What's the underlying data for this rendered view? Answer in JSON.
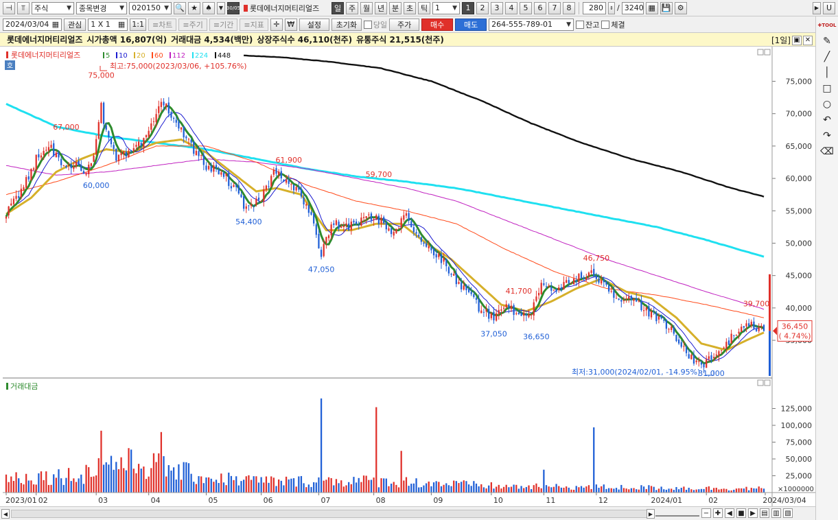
{
  "toolbar1": {
    "market": "주식",
    "stock_change": "종목변경",
    "code": "020150",
    "name": "롯데에너지머티리얼즈",
    "interval_selected": "일",
    "intervals": [
      "주",
      "월",
      "년",
      "분",
      "초",
      "틱"
    ],
    "count_value": "1",
    "pages": [
      "1",
      "2",
      "3",
      "4",
      "5",
      "6",
      "7",
      "8"
    ],
    "active_page": "1",
    "bars_value": "280",
    "slash": "/",
    "bars_total": "3240",
    "badge": "30/05",
    "right_u": "U"
  },
  "toolbar2": {
    "date": "2024/03/04",
    "watch": "관심",
    "layout": "1 X 1",
    "ratio": "1:1",
    "chart_btn": "≡차트",
    "period_btn": "≡주기",
    "range_btn": "≡기간",
    "indicator_btn": "≡지표",
    "won": "₩",
    "settings": "설정",
    "reset": "초기화",
    "today": "당일",
    "price": "주가",
    "buy": "매수",
    "sell": "매도",
    "account": "264-555-789-01",
    "balance": "잔고",
    "filled": "체결"
  },
  "infobar": {
    "name": "롯데에너지머티리얼즈",
    "mktcap": "시가총액 16,807(억)",
    "turnover": "거래대금 4,534(백만)",
    "listed": "상장주식수 46,110(천주)",
    "float": "유통주식 21,515(천주)",
    "period_badge": "[1일]"
  },
  "colors": {
    "up": "#e0302a",
    "down": "#1f5fd6",
    "ma5": "#2e8b2e",
    "ma10": "#1a1ad0",
    "ma20": "#d6b02a",
    "ma60": "#ff4a1a",
    "ma112": "#c020c0",
    "ma224": "#1fe0f0",
    "ma448": "#111111"
  },
  "chart_data": {
    "type": "candlestick",
    "legend_title": "롯데에너지머티리얼즈",
    "ma_labels": [
      {
        "period": "5",
        "color": "#2e8b2e"
      },
      {
        "period": "10",
        "color": "#1a1ad0"
      },
      {
        "period": "20",
        "color": "#d6b02a"
      },
      {
        "period": "60",
        "color": "#ff4a1a"
      },
      {
        "period": "112",
        "color": "#c020c0"
      },
      {
        "period": "224",
        "color": "#1fe0f0"
      },
      {
        "period": "448",
        "color": "#111111"
      }
    ],
    "ylim": [
      29500,
      79500
    ],
    "y_ticks": [
      "75,000",
      "70,000",
      "65,000",
      "60,000",
      "55,000",
      "50,000",
      "45,000",
      "40,000",
      "35,000"
    ],
    "x_ticks": [
      "2023/01",
      "02",
      "03",
      "04",
      "05",
      "06",
      "07",
      "08",
      "09",
      "10",
      "11",
      "12",
      "2024/01",
      "02",
      "2024/03/04"
    ],
    "month_index": [
      0,
      12,
      36,
      57,
      80,
      102,
      125,
      147,
      170,
      194,
      215,
      236,
      257,
      280,
      303
    ],
    "close_anchors": [
      [
        0,
        54800
      ],
      [
        6,
        58000
      ],
      [
        12,
        63000
      ],
      [
        18,
        64500
      ],
      [
        22,
        62500
      ],
      [
        28,
        62000
      ],
      [
        32,
        61000
      ],
      [
        35,
        64000
      ],
      [
        38,
        71000
      ],
      [
        40,
        67000
      ],
      [
        44,
        63000
      ],
      [
        50,
        64000
      ],
      [
        56,
        66000
      ],
      [
        62,
        72000
      ],
      [
        66,
        70000
      ],
      [
        72,
        66000
      ],
      [
        80,
        62000
      ],
      [
        87,
        60500
      ],
      [
        92,
        58000
      ],
      [
        96,
        55000
      ],
      [
        102,
        57000
      ],
      [
        107,
        61000
      ],
      [
        112,
        60000
      ],
      [
        117,
        58000
      ],
      [
        122,
        54000
      ],
      [
        126,
        48000
      ],
      [
        130,
        53000
      ],
      [
        137,
        52500
      ],
      [
        145,
        54000
      ],
      [
        150,
        53500
      ],
      [
        155,
        51500
      ],
      [
        160,
        54500
      ],
      [
        165,
        50500
      ],
      [
        170,
        49000
      ],
      [
        175,
        47000
      ],
      [
        180,
        44000
      ],
      [
        185,
        42500
      ],
      [
        190,
        39500
      ],
      [
        195,
        38500
      ],
      [
        200,
        41000
      ],
      [
        205,
        38500
      ],
      [
        210,
        39500
      ],
      [
        214,
        44000
      ],
      [
        220,
        42500
      ],
      [
        226,
        44500
      ],
      [
        230,
        45000
      ],
      [
        235,
        45500
      ],
      [
        240,
        43000
      ],
      [
        246,
        41500
      ],
      [
        252,
        41000
      ],
      [
        258,
        39000
      ],
      [
        265,
        37000
      ],
      [
        270,
        34000
      ],
      [
        275,
        32000
      ],
      [
        279,
        31500
      ],
      [
        283,
        32500
      ],
      [
        288,
        34500
      ],
      [
        295,
        37500
      ],
      [
        300,
        37000
      ],
      [
        303,
        36450
      ]
    ],
    "ma_anchors": {
      "ma20": [
        [
          0,
          54500
        ],
        [
          10,
          57000
        ],
        [
          20,
          61000
        ],
        [
          30,
          63000
        ],
        [
          40,
          64500
        ],
        [
          50,
          64000
        ],
        [
          60,
          65500
        ],
        [
          70,
          66000
        ],
        [
          80,
          64000
        ],
        [
          90,
          61000
        ],
        [
          100,
          58000
        ],
        [
          108,
          58500
        ],
        [
          118,
          57500
        ],
        [
          128,
          52000
        ],
        [
          138,
          52000
        ],
        [
          148,
          53000
        ],
        [
          158,
          53000
        ],
        [
          168,
          50000
        ],
        [
          178,
          47500
        ],
        [
          188,
          44000
        ],
        [
          198,
          40500
        ],
        [
          208,
          39500
        ],
        [
          218,
          41000
        ],
        [
          228,
          43000
        ],
        [
          238,
          44500
        ],
        [
          248,
          42500
        ],
        [
          258,
          41500
        ],
        [
          268,
          38500
        ],
        [
          278,
          34500
        ],
        [
          288,
          33500
        ],
        [
          296,
          35000
        ],
        [
          303,
          36200
        ]
      ],
      "ma60": [
        [
          0,
          57500
        ],
        [
          20,
          59500
        ],
        [
          40,
          62000
        ],
        [
          60,
          65000
        ],
        [
          80,
          65000
        ],
        [
          100,
          62500
        ],
        [
          120,
          59000
        ],
        [
          140,
          56500
        ],
        [
          160,
          55000
        ],
        [
          180,
          53000
        ],
        [
          200,
          49000
        ],
        [
          220,
          45500
        ],
        [
          240,
          43000
        ],
        [
          260,
          42000
        ],
        [
          280,
          40500
        ],
        [
          303,
          38500
        ]
      ],
      "ma112": [
        [
          0,
          62000
        ],
        [
          20,
          60500
        ],
        [
          40,
          61000
        ],
        [
          60,
          62000
        ],
        [
          80,
          63000
        ],
        [
          100,
          62500
        ],
        [
          120,
          61500
        ],
        [
          140,
          60000
        ],
        [
          160,
          58500
        ],
        [
          180,
          56500
        ],
        [
          200,
          53500
        ],
        [
          220,
          50500
        ],
        [
          240,
          47500
        ],
        [
          260,
          45000
        ],
        [
          280,
          42500
        ],
        [
          303,
          39800
        ]
      ],
      "ma224": [
        [
          0,
          71500
        ],
        [
          20,
          68000
        ],
        [
          40,
          66500
        ],
        [
          60,
          65500
        ],
        [
          80,
          64500
        ],
        [
          100,
          63000
        ],
        [
          120,
          61500
        ],
        [
          140,
          60300
        ],
        [
          160,
          59500
        ],
        [
          180,
          58500
        ],
        [
          200,
          57000
        ],
        [
          220,
          55500
        ],
        [
          240,
          54000
        ],
        [
          260,
          52500
        ],
        [
          280,
          50500
        ],
        [
          303,
          47900
        ]
      ],
      "ma448": [
        [
          95,
          79000
        ],
        [
          110,
          78700
        ],
        [
          130,
          78000
        ],
        [
          150,
          77000
        ],
        [
          170,
          75000
        ],
        [
          190,
          72000
        ],
        [
          210,
          68500
        ],
        [
          230,
          65500
        ],
        [
          250,
          63000
        ],
        [
          270,
          61000
        ],
        [
          290,
          58500
        ],
        [
          303,
          57200
        ]
      ]
    },
    "annotations": [
      {
        "text": "67,000",
        "i": 24,
        "price": 67000,
        "kind": "high"
      },
      {
        "text": "75,000",
        "i": 38,
        "price": 75000,
        "kind": "high"
      },
      {
        "text": "60,000",
        "i": 36,
        "price": 60000,
        "kind": "low"
      },
      {
        "text": "54,400",
        "i": 97,
        "price": 54400,
        "kind": "low"
      },
      {
        "text": "61,900",
        "i": 113,
        "price": 61900,
        "kind": "high"
      },
      {
        "text": "47,050",
        "i": 126,
        "price": 47050,
        "kind": "low"
      },
      {
        "text": "59,700",
        "i": 149,
        "price": 59700,
        "kind": "high"
      },
      {
        "text": "37,050",
        "i": 195,
        "price": 37050,
        "kind": "low"
      },
      {
        "text": "41,700",
        "i": 205,
        "price": 41700,
        "kind": "high"
      },
      {
        "text": "36,650",
        "i": 212,
        "price": 36650,
        "kind": "low"
      },
      {
        "text": "46,750",
        "i": 236,
        "price": 46750,
        "kind": "high"
      },
      {
        "text": "39,700",
        "i": 300,
        "price": 39700,
        "kind": "high"
      },
      {
        "text": "31,000",
        "i": 282,
        "price": 31000,
        "kind": "low"
      }
    ],
    "max_note": "최고:75,000(2023/03/06, +105.76%)",
    "min_note": "최저:31,000(2024/02/01, -14.95%)",
    "current_price": "36,450",
    "current_change": "( 4.74%)",
    "current_value": 36450,
    "series_badge": "호",
    "volume": {
      "title": "거래대금",
      "ylim": [
        0,
        150000
      ],
      "y_ticks": [
        "125,000",
        "100,000",
        "75,000",
        "50,000",
        "25,000"
      ],
      "unit": "×1000000",
      "spikes": [
        [
          38,
          92000
        ],
        [
          62,
          90000
        ],
        [
          126,
          140000
        ],
        [
          148,
          127000
        ],
        [
          158,
          62000
        ],
        [
          215,
          34000
        ],
        [
          235,
          97000
        ]
      ],
      "base_anchors": [
        [
          0,
          22000
        ],
        [
          30,
          26000
        ],
        [
          40,
          46000
        ],
        [
          60,
          40000
        ],
        [
          80,
          22000
        ],
        [
          110,
          16000
        ],
        [
          130,
          18000
        ],
        [
          160,
          16000
        ],
        [
          200,
          9000
        ],
        [
          240,
          8000
        ],
        [
          280,
          6500
        ],
        [
          303,
          6000
        ]
      ]
    }
  }
}
